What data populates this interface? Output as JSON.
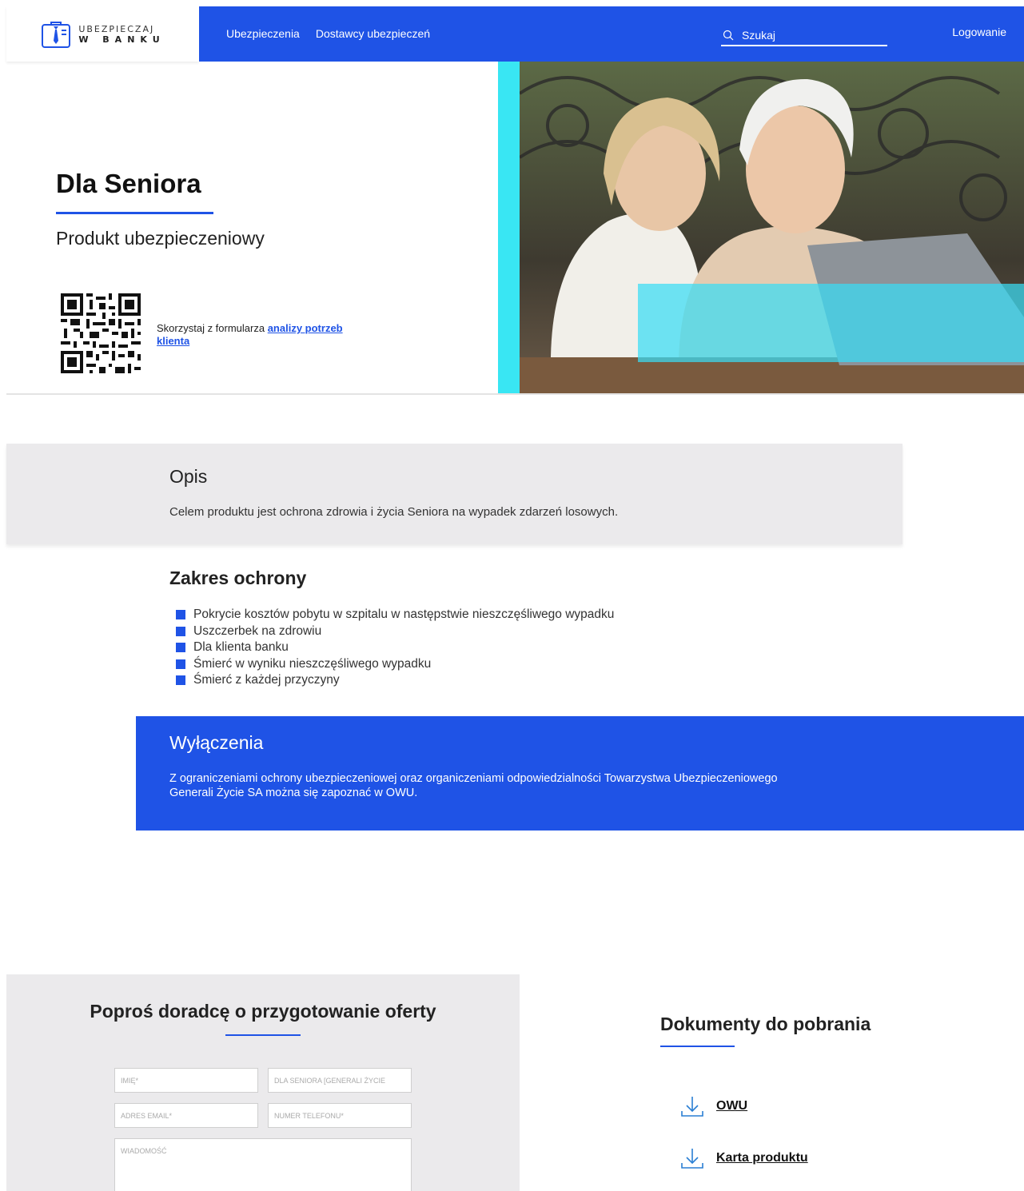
{
  "header": {
    "logo": {
      "line1": "UBEZPIECZAJ",
      "line2": "W BANKU"
    },
    "nav": [
      {
        "label": "Ubezpieczenia"
      },
      {
        "label": "Dostawcy ubezpieczeń"
      }
    ],
    "search_placeholder": "Szukaj",
    "login_label": "Logowanie"
  },
  "hero": {
    "title": "Dla Seniora",
    "subtitle": "Produkt ubezpieczeniowy",
    "qr_text_prefix": "Skorzystaj z formularza ",
    "qr_link": "analizy potrzeb klienta"
  },
  "opis": {
    "title": "Opis",
    "text": "Celem produktu jest ochrona zdrowia i życia Seniora na wypadek zdarzeń losowych."
  },
  "zakres": {
    "title": "Zakres ochrony",
    "items": [
      "Pokrycie kosztów pobytu w szpitalu w następstwie nieszczęśliwego wypadku",
      "Uszczerbek na zdrowiu",
      "Dla klienta banku",
      "Śmierć w wyniku nieszczęśliwego wypadku",
      "Śmierć z każdej przyczyny"
    ]
  },
  "wylaczenia": {
    "title": "Wyłączenia",
    "text": "Z ograniczeniami ochrony ubezpieczeniowej oraz organiczeniami odpowiedzialności Towarzystwa Ubezpieczeniowego Generali Życie SA można się zapoznać w OWU."
  },
  "form": {
    "title": "Poproś doradcę o przygotowanie oferty",
    "name_placeholder": "IMIĘ*",
    "product_placeholder": "DLA SENIORA [GENERALI ŻYCIE",
    "email_placeholder": "ADRES EMAIL*",
    "phone_placeholder": "NUMER TELEFONU*",
    "message_placeholder": "WIADOMOŚĆ"
  },
  "docs": {
    "title": "Dokumenty do pobrania",
    "items": [
      {
        "label": "OWU"
      },
      {
        "label": "Karta produktu"
      }
    ]
  },
  "colors": {
    "primary": "#1f53e6",
    "cyan": "#39e6f3",
    "panel": "#ebeaec"
  }
}
